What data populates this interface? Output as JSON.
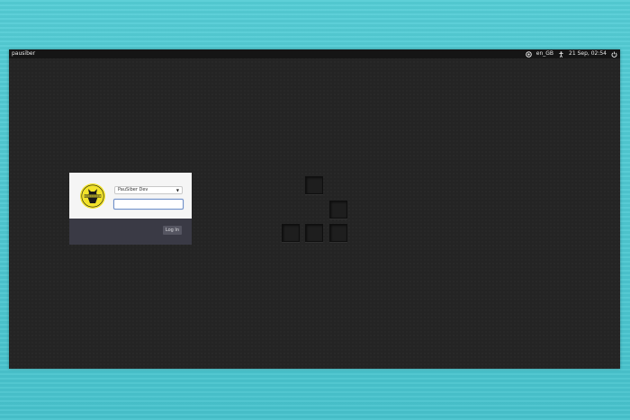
{
  "topbar": {
    "hostname": "pausiber",
    "keyboard_layout": "en_GB",
    "datetime": "21 Sep, 02:54",
    "icons": [
      "accessibility-circle-icon",
      "accessibility-person-icon",
      "power-icon"
    ]
  },
  "login": {
    "selected_user": "PauSiber Dev",
    "password_value": "",
    "login_button_label": "Log In",
    "avatar_icon": "pausiber-logo-icon",
    "avatar_color": "#f2e32a"
  },
  "background_logo": {
    "icon": "ubuntu-dots-logo",
    "block_count": 5
  },
  "colors": {
    "desktop_frame": "#4fc8d2",
    "screen_background": "#242424",
    "panel": "#151515",
    "login_footer": "#3a3a45"
  }
}
